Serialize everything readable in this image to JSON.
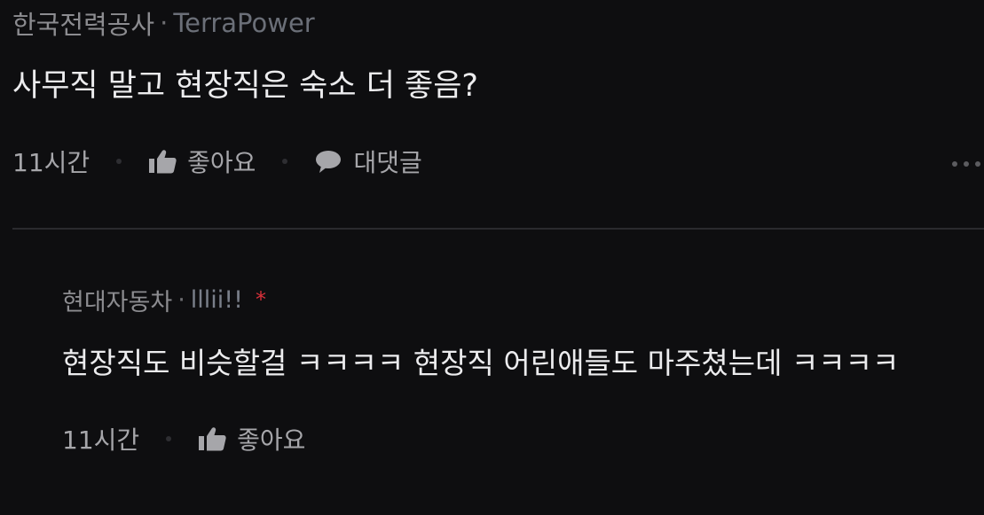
{
  "post": {
    "company": "한국전력공사",
    "separator": "·",
    "company_alt": "TerraPower",
    "text": "사무직 말고 현장직은 숙소 더 좋음?",
    "time": "11시간",
    "like_label": "좋아요",
    "reply_label": "대댓글"
  },
  "reply": {
    "company": "현대자동차",
    "separator": "·",
    "nickname": "lllii!!",
    "author_mark": "*",
    "text": "현장직도 비슷할걸 ㅋㅋㅋㅋ 현장직 어린애들도 마주쳤는데 ㅋㅋㅋㅋ",
    "time": "11시간",
    "like_label": "좋아요"
  },
  "icons": {
    "like": "thumbs-up-icon",
    "reply": "speech-bubble-icon",
    "more": "more-horizontal-icon"
  },
  "colors": {
    "background": "#0e0e10",
    "primary_text": "#ececee",
    "secondary_text": "#8c8c90",
    "author_star": "#d8303a"
  }
}
